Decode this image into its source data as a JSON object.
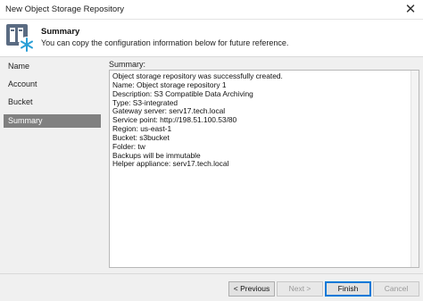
{
  "window": {
    "title": "New Object Storage Repository"
  },
  "header": {
    "title": "Summary",
    "subtitle": "You can copy the configuration information below for future reference.",
    "logo_icon": "object-storage-snowflake-icon",
    "colors": {
      "tile": "#5a6b82",
      "accent": "#2a9fd6"
    }
  },
  "nav": {
    "items": [
      {
        "label": "Name"
      },
      {
        "label": "Account"
      },
      {
        "label": "Bucket"
      },
      {
        "label": "Summary"
      }
    ],
    "active_color": "#808080"
  },
  "summary": {
    "label": "Summary:",
    "lines": [
      "Object storage repository was successfully created.",
      "Name: Object storage repository 1",
      "Description: S3 Compatible Data Archiving",
      "Type: S3-integrated",
      "Gateway server: serv17.tech.local",
      "Service point: http://198.51.100.53/80",
      "Region: us-east-1",
      "Bucket: s3bucket",
      "Folder: tw",
      "Backups will be immutable",
      "Helper appliance: serv17.tech.local"
    ]
  },
  "footer": {
    "previous_label": "< Previous",
    "next_label": "Next >",
    "finish_label": "Finish",
    "cancel_label": "Cancel"
  }
}
